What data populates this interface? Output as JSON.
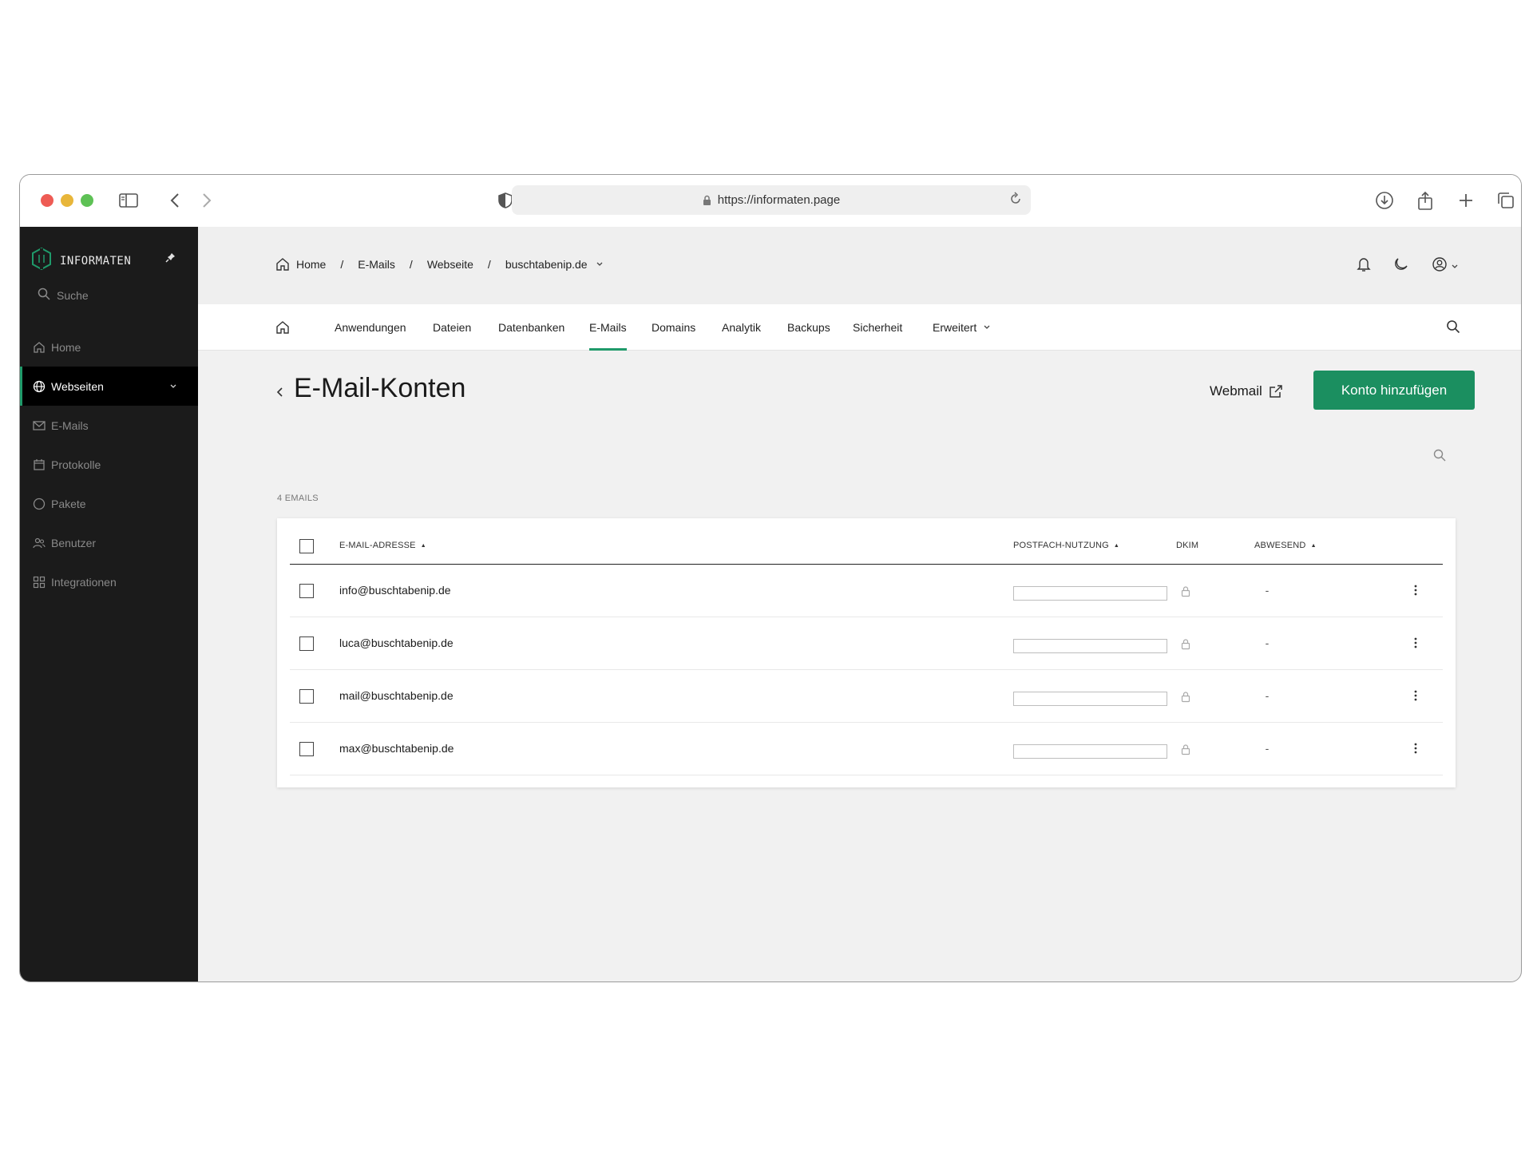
{
  "browser": {
    "url": "https://informaten.page"
  },
  "sidebar": {
    "brand": "INFORMATEN",
    "search_label": "Suche",
    "items": [
      {
        "label": "Home",
        "icon": "home-icon"
      },
      {
        "label": "Webseiten",
        "icon": "globe-icon",
        "active": true
      },
      {
        "label": "E-Mails",
        "icon": "mail-icon"
      },
      {
        "label": "Protokolle",
        "icon": "calendar-icon"
      },
      {
        "label": "Pakete",
        "icon": "circle-icon"
      },
      {
        "label": "Benutzer",
        "icon": "users-icon"
      },
      {
        "label": "Integrationen",
        "icon": "grid-icon"
      }
    ]
  },
  "breadcrumb": {
    "items": [
      "Home",
      "E-Mails",
      "Webseite",
      "buschtabenip.de"
    ]
  },
  "tabs": {
    "items": [
      "Anwendungen",
      "Dateien",
      "Datenbanken",
      "E-Mails",
      "Domains",
      "Analytik",
      "Backups",
      "Sicherheit",
      "Erweitert"
    ],
    "active": "E-Mails"
  },
  "page": {
    "title": "E-Mail-Konten",
    "webmail_label": "Webmail",
    "add_button_label": "Konto hinzufügen",
    "count_label": "4 EMAILS"
  },
  "table": {
    "headers": {
      "email": "E-MAIL-ADRESSE",
      "usage": "POSTFACH-NUTZUNG",
      "dkim": "DKIM",
      "away": "ABWESEND"
    },
    "rows": [
      {
        "email": "info@buschtabenip.de",
        "away": "-"
      },
      {
        "email": "luca@buschtabenip.de",
        "away": "-"
      },
      {
        "email": "mail@buschtabenip.de",
        "away": "-"
      },
      {
        "email": "max@buschtabenip.de",
        "away": "-"
      }
    ]
  },
  "colors": {
    "accent": "#1b8f60",
    "sidebar_bg": "#1b1b1b"
  }
}
